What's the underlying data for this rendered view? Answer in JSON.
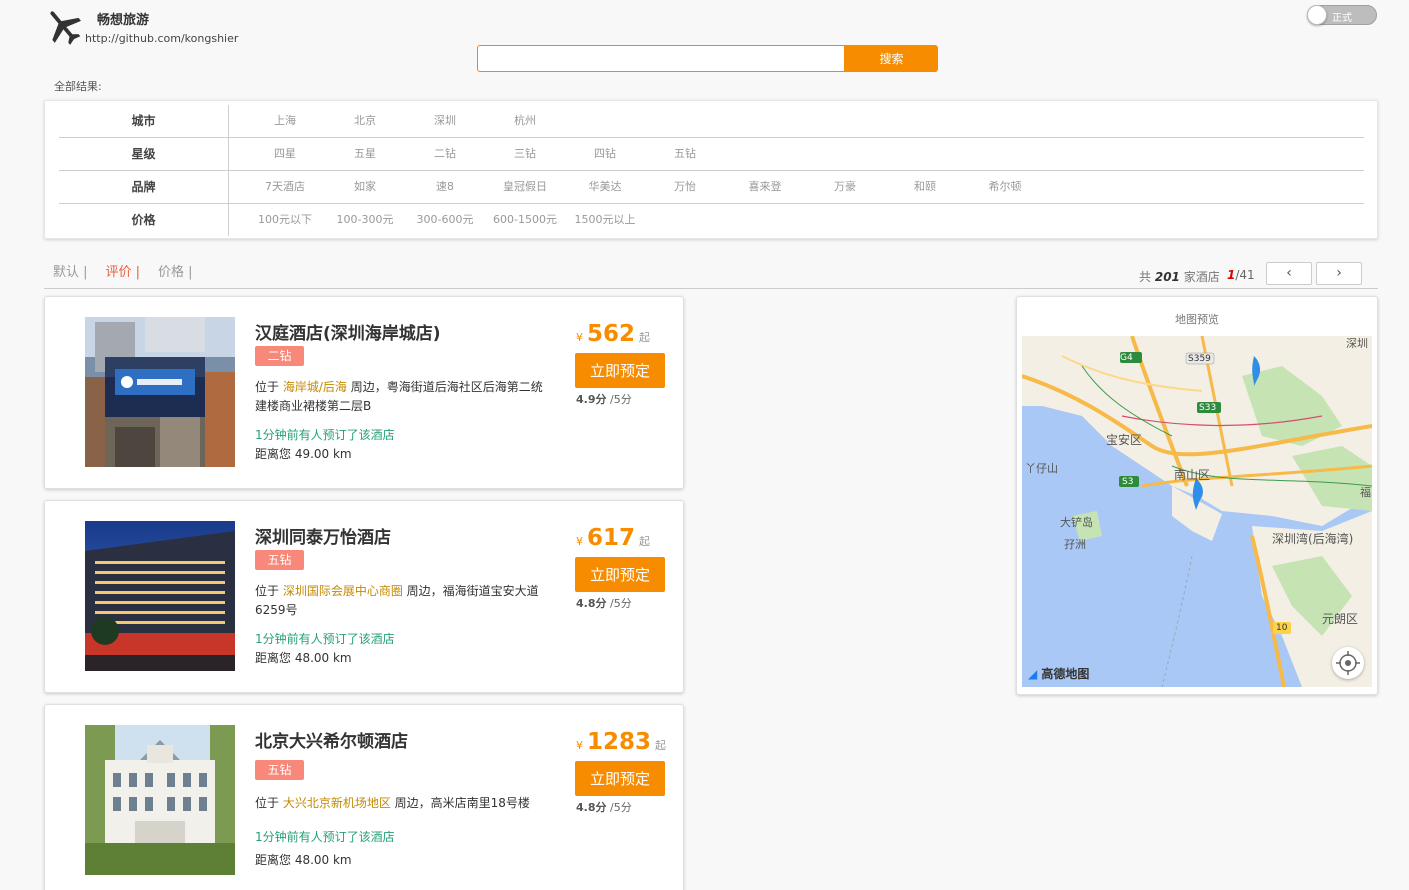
{
  "header": {
    "brand_name": "畅想旅游",
    "brand_url": "http://github.com/kongshier",
    "toggle_label": "正式"
  },
  "search": {
    "value": "",
    "placeholder": "",
    "button_label": "搜索"
  },
  "results_label": "全部结果:",
  "filters": [
    {
      "label": "城市",
      "options": [
        "上海",
        "北京",
        "深圳",
        "杭州"
      ]
    },
    {
      "label": "星级",
      "options": [
        "四星",
        "五星",
        "二钻",
        "三钻",
        "四钻",
        "五钻"
      ]
    },
    {
      "label": "品牌",
      "options": [
        "7天酒店",
        "如家",
        "速8",
        "皇冠假日",
        "华美达",
        "万怡",
        "喜来登",
        "万豪",
        "和颐",
        "希尔顿"
      ]
    },
    {
      "label": "价格",
      "options": [
        "100元以下",
        "100-300元",
        "300-600元",
        "600-1500元",
        "1500元以上"
      ]
    }
  ],
  "sort": {
    "items": [
      "默认 |",
      "评价 |",
      "价格 |"
    ],
    "active_index": 1
  },
  "pagination": {
    "total_prefix": "共",
    "total": "201",
    "total_suffix": "家酒店",
    "current_page": "1",
    "total_pages": "/41",
    "prev_icon": "‹",
    "next_icon": "›"
  },
  "hotels": [
    {
      "name": "汉庭酒店(深圳海岸城店)",
      "tag": "二钻",
      "addr_prefix": "位于 ",
      "area": "海岸城/后海",
      "addr_suffix": " 周边，粤海街道后海社区后海第二统建楼商业裙楼第二层B",
      "booked": "1分钟前有人预订了该酒店",
      "distance": "距离您 49.00 km",
      "currency": "¥",
      "price": "562",
      "price_from": "起",
      "book_label": "立即预定",
      "score": "4.9分",
      "score_max": "/5分"
    },
    {
      "name": "深圳同泰万怡酒店",
      "tag": "五钻",
      "addr_prefix": "位于 ",
      "area": "深圳国际会展中心商圈",
      "addr_suffix": " 周边，福海街道宝安大道 6259号",
      "booked": "1分钟前有人预订了该酒店",
      "distance": "距离您 48.00 km",
      "currency": "¥",
      "price": "617",
      "price_from": "起",
      "book_label": "立即预定",
      "score": "4.8分",
      "score_max": "/5分"
    },
    {
      "name": "北京大兴希尔顿酒店",
      "tag": "五钻",
      "addr_prefix": "位于 ",
      "area": "大兴北京新机场地区",
      "addr_suffix": " 周边，高米店南里18号楼",
      "booked": "1分钟前有人预订了该酒店",
      "distance": "距离您 48.00 km",
      "currency": "¥",
      "price": "1283",
      "price_from": "起",
      "book_label": "立即预定",
      "score": "4.8分",
      "score_max": "/5分"
    }
  ],
  "map": {
    "title": "地图预览",
    "logo": "高德地图",
    "labels": [
      "宝安区",
      "南山区",
      "深圳湾(后海湾)",
      "元朗区",
      "大铲岛",
      "孖洲",
      "丫仔山",
      "深圳",
      "福"
    ],
    "road_badges": [
      "G4",
      "S359",
      "S33",
      "S3",
      "10"
    ]
  },
  "colors": {
    "accent": "#f78c00",
    "tag": "#f8897a",
    "booked": "#25a07a",
    "area": "#c48a00",
    "sort_active": "#e8603c"
  }
}
